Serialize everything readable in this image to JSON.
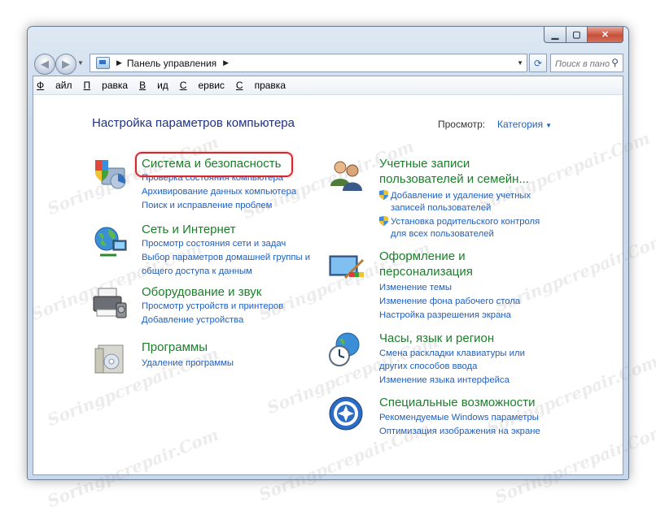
{
  "address": {
    "path": "Панель управления"
  },
  "search": {
    "placeholder": "Поиск в пано"
  },
  "menu": {
    "file": "Файл",
    "edit": "Правка",
    "view": "Вид",
    "tools": "Сервис",
    "help": "Справка"
  },
  "heading": "Настройка параметров компьютера",
  "view_by": {
    "label": "Просмотр:",
    "value": "Категория"
  },
  "watermark": "Soringpcrepair.Com",
  "left_column": [
    {
      "title": "Система и безопасность",
      "links": [
        "Проверка состояния компьютера",
        "Архивирование данных компьютера",
        "Поиск и исправление проблем"
      ]
    },
    {
      "title": "Сеть и Интернет",
      "links": [
        "Просмотр состояния сети и задач",
        "Выбор параметров домашней группы и",
        "общего доступа к данным"
      ]
    },
    {
      "title": "Оборудование и звук",
      "links": [
        "Просмотр устройств и принтеров",
        "Добавление устройства"
      ]
    },
    {
      "title": "Программы",
      "links": [
        "Удаление программы"
      ]
    }
  ],
  "right_column": [
    {
      "title_line1": "Учетные записи",
      "title_line2": "пользователей и семейн...",
      "links": [
        "Добавление и удаление учетных",
        "записей пользователей",
        "Установка родительского контроля",
        "для всех пользователей"
      ]
    },
    {
      "title_line1": "Оформление и",
      "title_line2": "персонализация",
      "links": [
        "Изменение темы",
        "Изменение фона рабочего стола",
        "Настройка разрешения экрана"
      ]
    },
    {
      "title": "Часы, язык и регион",
      "links": [
        "Смена раскладки клавиатуры или",
        "других способов ввода",
        "Изменение языка интерфейса"
      ]
    },
    {
      "title": "Специальные возможности",
      "links": [
        "Рекомендуемые Windows параметры",
        "Оптимизация изображения на экране"
      ]
    }
  ]
}
